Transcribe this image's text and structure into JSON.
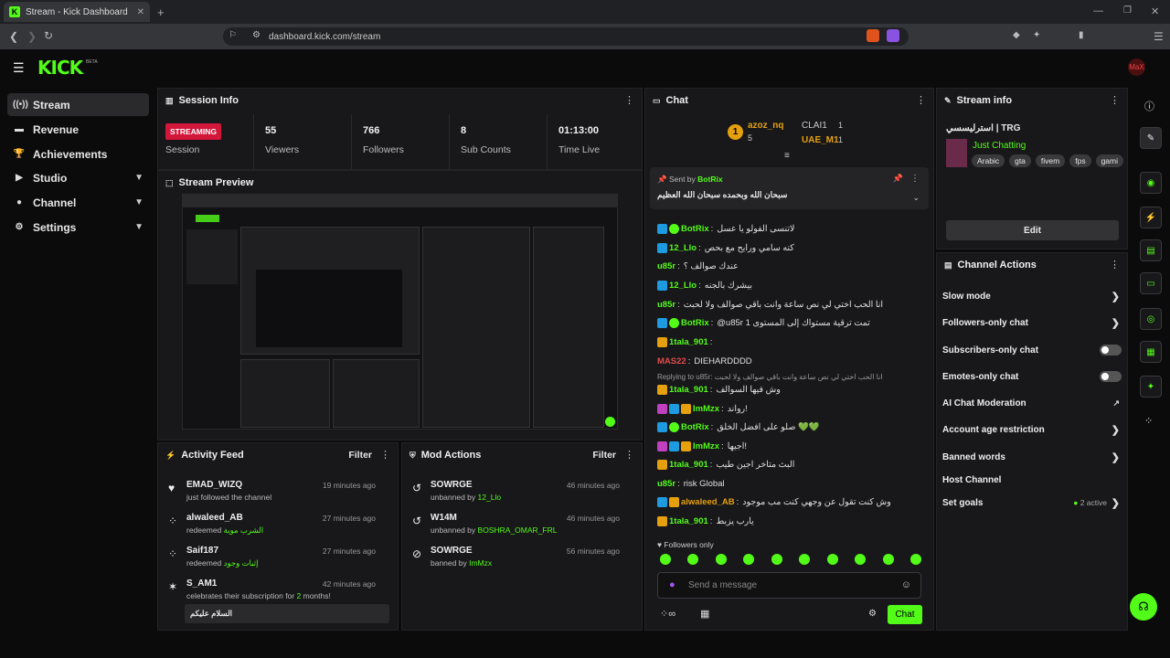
{
  "browser": {
    "tab_title": "Stream - Kick Dashboard",
    "url": "dashboard.kick.com/stream"
  },
  "brand": {
    "logo": "KICK",
    "beta": "BETA",
    "avatar_text": "MaX",
    "accent": "#53fc18"
  },
  "sidebar": {
    "items": [
      {
        "label": "Stream",
        "icon": "signal-icon",
        "active": true
      },
      {
        "label": "Revenue",
        "icon": "money-icon"
      },
      {
        "label": "Achievements",
        "icon": "trophy-icon"
      },
      {
        "label": "Studio",
        "icon": "video-icon",
        "expandable": true
      },
      {
        "label": "Channel",
        "icon": "user-icon",
        "expandable": true
      },
      {
        "label": "Settings",
        "icon": "gear-icon",
        "expandable": true
      }
    ]
  },
  "session_info": {
    "title": "Session Info",
    "badge": "STREAMING",
    "badge_label": "Session",
    "stats": [
      {
        "value": "55",
        "label": "Viewers"
      },
      {
        "value": "766",
        "label": "Followers"
      },
      {
        "value": "8",
        "label": "Sub Counts"
      },
      {
        "value": "01:13:00",
        "label": "Time Live"
      }
    ]
  },
  "preview": {
    "title": "Stream Preview"
  },
  "activity": {
    "title": "Activity Feed",
    "filter": "Filter",
    "items": [
      {
        "name": "EMAD_WIZQ",
        "sub": "just followed the channel",
        "time": "19 minutes ago",
        "icon": "heart-icon"
      },
      {
        "name": "alwaleed_AB",
        "sub": "redeemed",
        "reward": "الشرب موية",
        "time": "27 minutes ago",
        "icon": "reward-icon"
      },
      {
        "name": "Saif187",
        "sub": "redeemed",
        "reward": "إثبات وجود",
        "time": "27 minutes ago",
        "icon": "reward-icon"
      },
      {
        "name": "S_AM1",
        "sub_pre": "celebrates their subscription for",
        "months": "2",
        "sub_post": "months!",
        "message": "السلام عليكم",
        "time": "42 minutes ago",
        "icon": "star-icon"
      }
    ]
  },
  "mod_actions": {
    "title": "Mod Actions",
    "filter": "Filter",
    "items": [
      {
        "name": "SOWRGE",
        "action": "unbanned by",
        "by": "12_Llo",
        "time": "46 minutes ago",
        "icon": "undo-icon"
      },
      {
        "name": "W14M",
        "action": "unbanned by",
        "by": "BOSHRA_OMAR_FRL",
        "time": "46 minutes ago",
        "icon": "undo-icon"
      },
      {
        "name": "SOWRGE",
        "action": "banned by",
        "by": "ImMzx",
        "time": "56 minutes ago",
        "icon": "ban-icon"
      }
    ]
  },
  "chat": {
    "title": "Chat",
    "top_gifters": [
      {
        "rank": "1",
        "name": "azoz_nq",
        "count": "5"
      },
      {
        "name": "CLAI1",
        "count": "1"
      },
      {
        "name": "UAE_M1",
        "count": "1"
      }
    ],
    "pinned": {
      "sent_by": "Sent by",
      "user": "BotRix",
      "text": "سبحان الله وبحمده سبحان الله العظيم"
    },
    "messages": [
      {
        "user": "BotRix",
        "color": "#53fc18",
        "badges": [
          "mod",
          "ver"
        ],
        "text": "لاتنسى الفولو يا عسل"
      },
      {
        "user": "12_Llo",
        "color": "#53fc18",
        "badges": [
          "mod"
        ],
        "text": "كنه سامي ورايح مع بحص"
      },
      {
        "user": "u85r",
        "color": "#53fc18",
        "badges": [],
        "text": "عندك صوالف ؟"
      },
      {
        "user": "12_Llo",
        "color": "#53fc18",
        "badges": [
          "mod"
        ],
        "text": "بيشرك بالجنه"
      },
      {
        "user": "u85r",
        "color": "#53fc18",
        "badges": [],
        "text": "انا الحب اختي لي نص ساعة وانت باقي صوالف ولا لحبت"
      },
      {
        "user": "BotRix",
        "color": "#53fc18",
        "badges": [
          "mod",
          "ver"
        ],
        "text": "@u85r تمت ترقية مستواك إلى المستوى 1"
      },
      {
        "user": "1tala_901",
        "color": "#53fc18",
        "badges": [
          "sub"
        ],
        "text": ""
      },
      {
        "user": "MAS22",
        "color": "#e24b4b",
        "badges": [],
        "text": "DIEHARDDDD"
      },
      {
        "reply": "Replying to u85r: انا الحب اختي لي نص ساعة وانت باقي صوالف ولا لحبت"
      },
      {
        "user": "1tala_901",
        "color": "#53fc18",
        "badges": [
          "sub"
        ],
        "text": "وش فيها السوالف"
      },
      {
        "user": "ImMzx",
        "color": "#53fc18",
        "badges": [
          "vip",
          "mod",
          "sub"
        ],
        "text": "رواند!"
      },
      {
        "user": "BotRix",
        "color": "#53fc18",
        "badges": [
          "mod",
          "ver"
        ],
        "text": "صلو على افضل الخلق 💚💚"
      },
      {
        "user": "ImMzx",
        "color": "#53fc18",
        "badges": [
          "vip",
          "mod",
          "sub"
        ],
        "text": "اجيها!"
      },
      {
        "user": "1tala_901",
        "color": "#53fc18",
        "badges": [
          "sub"
        ],
        "text": "البث متاخر اجين طيب"
      },
      {
        "user": "u85r",
        "color": "#53fc18",
        "badges": [],
        "text": "risk Global"
      },
      {
        "user": "alwaleed_AB",
        "color": "#e5a00d",
        "badges": [
          "mod",
          "sub"
        ],
        "text": "وش كنت تقول عن وجهي كنت مب موجود"
      },
      {
        "user": "1tala_901",
        "color": "#53fc18",
        "badges": [
          "sub"
        ],
        "text": "يارب يزبط"
      }
    ],
    "followers_only": "Followers only",
    "input_placeholder": "Send a message",
    "send": "Chat"
  },
  "stream_info": {
    "title": "Stream info",
    "stream_title": "استرليسسي | TRG",
    "category": "Just Chatting",
    "tags": [
      "Arabic",
      "gta",
      "fivem",
      "fps",
      "gami"
    ],
    "edit": "Edit"
  },
  "channel_actions": {
    "title": "Channel Actions",
    "items": [
      {
        "label": "Slow mode",
        "control": "arrow"
      },
      {
        "label": "Followers-only chat",
        "control": "arrow"
      },
      {
        "label": "Subscribers-only chat",
        "control": "toggle"
      },
      {
        "label": "Emotes-only chat",
        "control": "toggle"
      },
      {
        "label": "AI Chat Moderation",
        "control": "external"
      },
      {
        "label": "Account age restriction",
        "control": "arrow"
      },
      {
        "label": "Banned words",
        "control": "arrow"
      },
      {
        "label": "Host Channel",
        "control": "none"
      },
      {
        "label": "Set goals",
        "control": "arrow",
        "status": "2 active"
      }
    ]
  }
}
